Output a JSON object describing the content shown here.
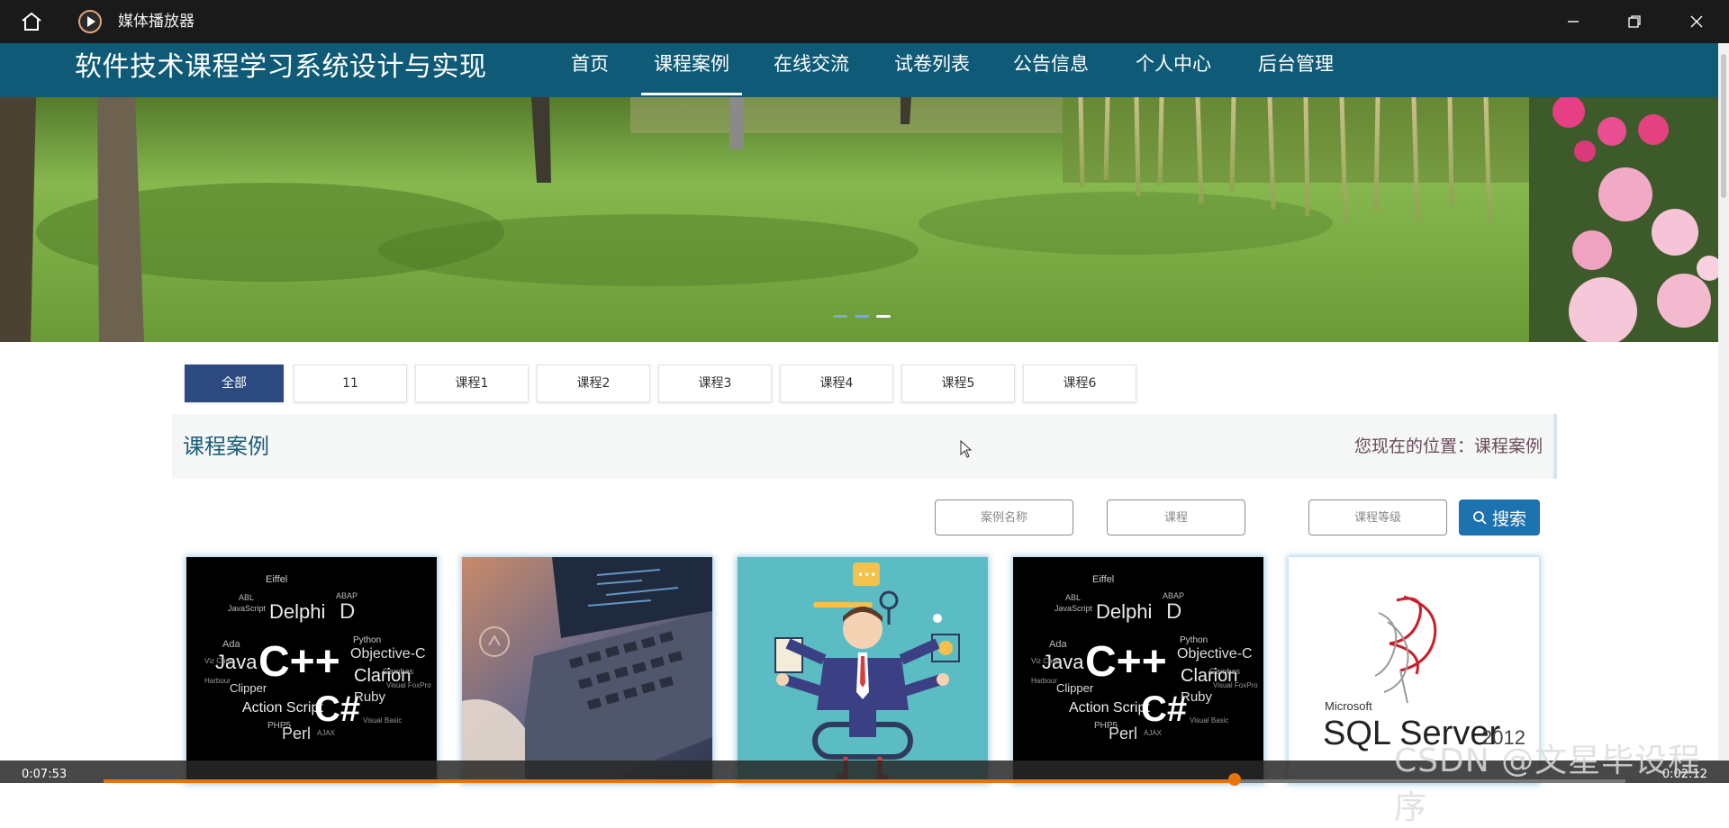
{
  "player": {
    "title": "媒体播放器",
    "time_elapsed": "0:07:53",
    "time_total": "0:02:12",
    "progress": 0.7434
  },
  "site": {
    "title": "软件技术课程学习系统设计与实现",
    "nav": [
      {
        "label": "首页",
        "active": false
      },
      {
        "label": "课程案例",
        "active": true
      },
      {
        "label": "在线交流",
        "active": false
      },
      {
        "label": "试卷列表",
        "active": false
      },
      {
        "label": "公告信息",
        "active": false
      },
      {
        "label": "个人中心",
        "active": false
      },
      {
        "label": "后台管理",
        "active": false
      }
    ]
  },
  "banner": {
    "slide_count": 3,
    "active_slide": 3
  },
  "categories": [
    {
      "label": "全部",
      "active": true
    },
    {
      "label": "11",
      "active": false
    },
    {
      "label": "课程1",
      "active": false
    },
    {
      "label": "课程2",
      "active": false
    },
    {
      "label": "课程3",
      "active": false
    },
    {
      "label": "课程4",
      "active": false
    },
    {
      "label": "课程5",
      "active": false
    },
    {
      "label": "课程6",
      "active": false
    }
  ],
  "page": {
    "title": "课程案例",
    "breadcrumb_prefix": "您现在的位置：",
    "breadcrumb_current": "课程案例"
  },
  "search": {
    "name_placeholder": "案例名称",
    "course_placeholder": "课程",
    "level_placeholder": "课程等级",
    "button_label": "搜索"
  },
  "cards": [
    {
      "image": "programming-languages-wordcloud"
    },
    {
      "image": "laptop-keyboard-code"
    },
    {
      "image": "multitasking-businessman-illustration"
    },
    {
      "image": "programming-languages-wordcloud"
    },
    {
      "image": "sql-server-2012-logo"
    }
  ],
  "card_text": {
    "wordcloud": {
      "big1": "C++",
      "big2": "C#",
      "java": "Java",
      "delphi": "Delphi",
      "d": "D",
      "objc": "Objective-C",
      "clarion": "Clarion",
      "as": "Action Script",
      "ruby": "Ruby",
      "perl": "Perl",
      "ada": "Ada",
      "clipper": "Clipper",
      "python": "Python",
      "gambas": "Gambas",
      "abap": "ABAP",
      "eiffel": "Eiffel",
      "abl": "ABL",
      "js": "JavaScript",
      "php": "PHP5",
      "ajax": "AJAX",
      "vbfox": "Visual FoxPro",
      "viz": "Viz Code",
      "harbour": "Harbour",
      "vb": "Visual Basic"
    },
    "sql": {
      "brand": "Microsoft",
      "product": "SQL Server",
      "version": "2012"
    }
  },
  "watermark": "CSDN @文星毕设程序",
  "colors": {
    "header_bg": "#0f5a76",
    "active_tab": "#2c4a7f",
    "search_button": "#1d72b0",
    "progress": "#e8720c"
  }
}
